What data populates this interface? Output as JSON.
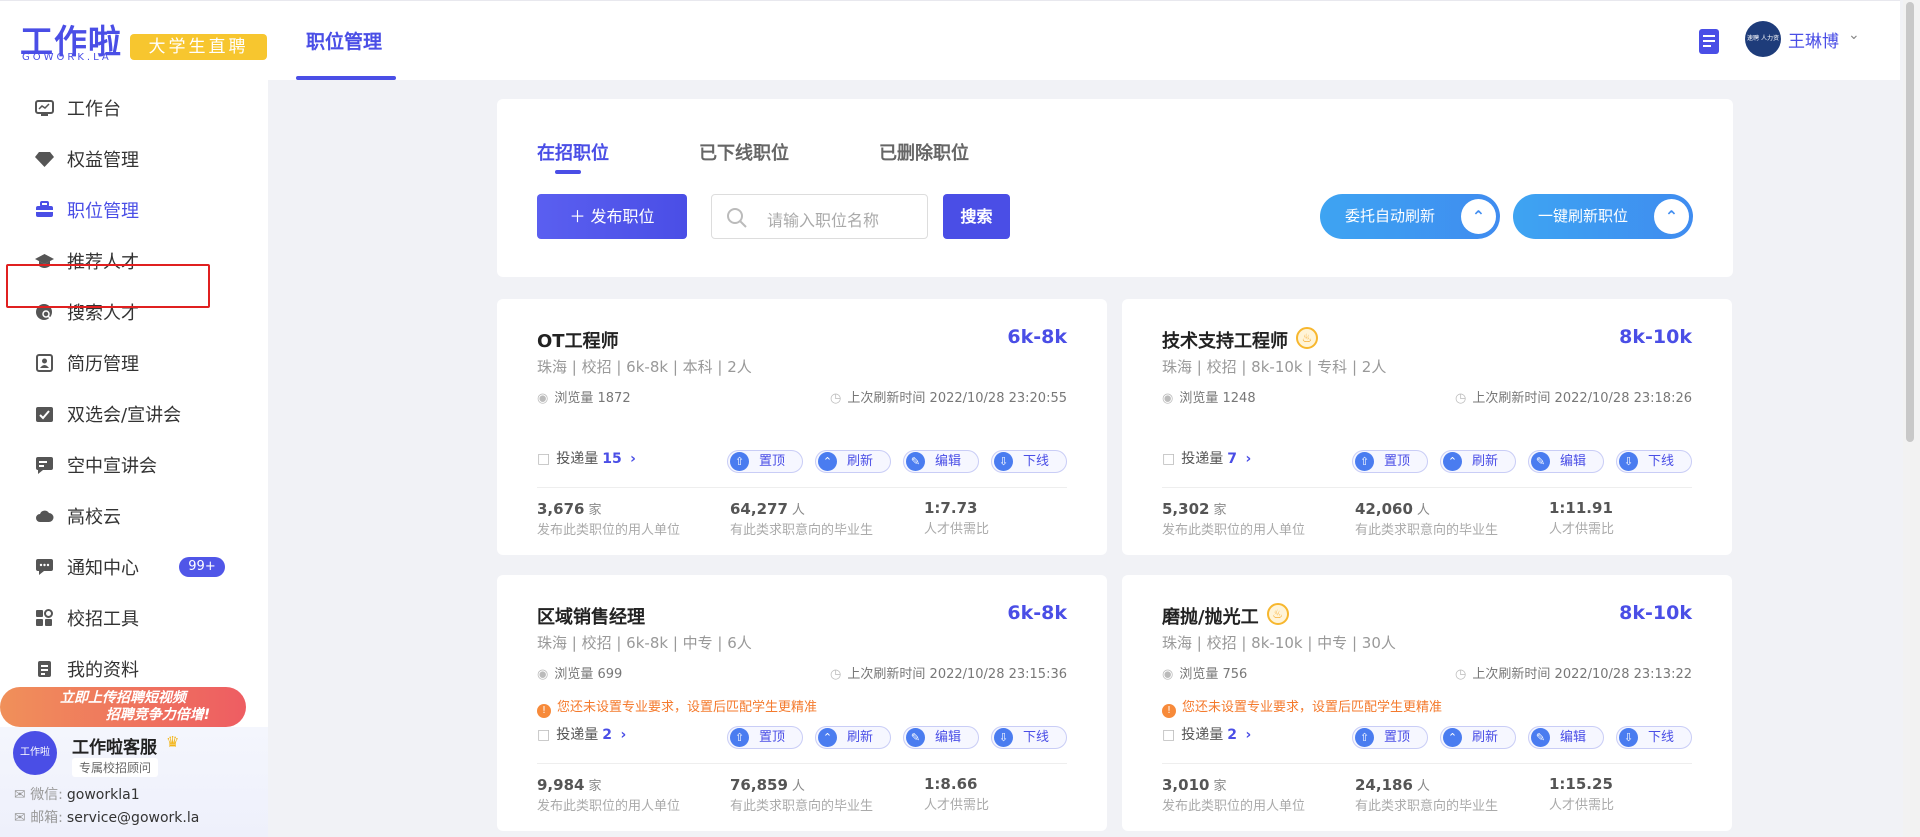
{
  "header": {
    "logo_text": "工作啦",
    "logo_sub": "GOWORK.LA",
    "logo_badge": "大学生直聘",
    "nav_active": "职位管理",
    "user_name": "王琳博",
    "user_avatar_text": "速聘 人力资源"
  },
  "sidebar": {
    "items": [
      {
        "label": "工作台",
        "icon": "dashboard-icon"
      },
      {
        "label": "权益管理",
        "icon": "diamond-icon"
      },
      {
        "label": "职位管理",
        "icon": "briefcase-icon"
      },
      {
        "label": "推荐人才",
        "icon": "graduation-cap-icon"
      },
      {
        "label": "搜索人才",
        "icon": "search-person-icon"
      },
      {
        "label": "简历管理",
        "icon": "resume-icon"
      },
      {
        "label": "双选会/宣讲会",
        "icon": "calendar-check-icon"
      },
      {
        "label": "空中宣讲会",
        "icon": "broadcast-icon"
      },
      {
        "label": "高校云",
        "icon": "cloud-icon"
      },
      {
        "label": "通知中心",
        "icon": "message-icon",
        "badge": "99+"
      },
      {
        "label": "校招工具",
        "icon": "tools-icon"
      },
      {
        "label": "我的资料",
        "icon": "profile-doc-icon"
      }
    ],
    "promo_line1": "立即上传招聘短视频",
    "promo_line2": "招聘竞争力倍增!",
    "service": {
      "name": "工作啦客服",
      "role": "专属校招顾问",
      "wechat_label": "微信:",
      "wechat": "goworkla1",
      "email_label": "邮箱:",
      "email": "service@gowork.la",
      "avatar_text": "工作啦"
    }
  },
  "toolbar": {
    "tabs": [
      "在招职位",
      "已下线职位",
      "已删除职位"
    ],
    "publish_label": "发布职位",
    "search_placeholder": "请输入职位名称",
    "search_label": "搜索",
    "auto_refresh_label": "委托自动刷新",
    "refresh_all_label": "一键刷新职位"
  },
  "labels": {
    "views": "浏览量",
    "last_refresh": "上次刷新时间",
    "applications": "投递量",
    "top": "置顶",
    "refresh": "刷新",
    "edit": "编辑",
    "offline": "下线",
    "unit_company": "家",
    "unit_person": "人",
    "stat1": "发布此类职位的用人单位",
    "stat2": "有此类求职意向的毕业生",
    "stat3": "人才供需比",
    "warning": "您还未设置专业要求，设置后匹配学生更精准"
  },
  "jobs": [
    {
      "title": "OT工程师",
      "hot": false,
      "salary": "6k-8k",
      "meta": "珠海 | 校招 | 6k-8k | 本科 | 2人",
      "views": "1872",
      "refresh_time": "2022/10/28 23:20:55",
      "warn": false,
      "applications": "15",
      "companies": "3,676",
      "graduates": "64,277",
      "ratio": "1:7.73"
    },
    {
      "title": "技术支持工程师",
      "hot": true,
      "salary": "8k-10k",
      "meta": "珠海 | 校招 | 8k-10k | 专科 | 2人",
      "views": "1248",
      "refresh_time": "2022/10/28 23:18:26",
      "warn": false,
      "applications": "7",
      "companies": "5,302",
      "graduates": "42,060",
      "ratio": "1:11.91"
    },
    {
      "title": "区域销售经理",
      "hot": false,
      "salary": "6k-8k",
      "meta": "珠海 | 校招 | 6k-8k | 中专 | 6人",
      "views": "699",
      "refresh_time": "2022/10/28 23:15:36",
      "warn": true,
      "applications": "2",
      "companies": "9,984",
      "graduates": "76,859",
      "ratio": "1:8.66"
    },
    {
      "title": "磨抛/抛光工",
      "hot": true,
      "salary": "8k-10k",
      "meta": "珠海 | 校招 | 8k-10k | 中专 | 30人",
      "views": "756",
      "refresh_time": "2022/10/28 23:13:22",
      "warn": true,
      "applications": "2",
      "companies": "3,010",
      "graduates": "24,186",
      "ratio": "1:15.25"
    }
  ]
}
